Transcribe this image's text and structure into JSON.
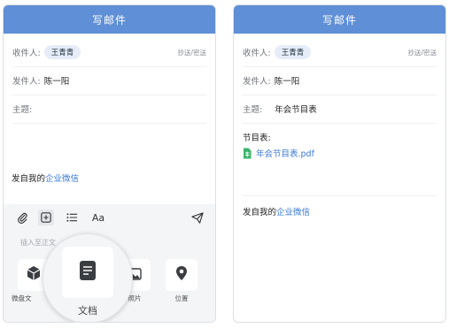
{
  "left": {
    "title": "写邮件",
    "to_label": "收件人:",
    "recipient": "王青青",
    "cc_bcc": "抄送/密送",
    "from_label": "发件人:",
    "from_value": "陈一阳",
    "subject_label": "主题:",
    "signature_prefix": "发自我的",
    "signature_link": "企业微信",
    "insert_hint": "插入至正文",
    "apps": [
      {
        "label": "微盘文",
        "icon": "cube-icon"
      },
      {
        "label": "照片",
        "icon": "photo-icon"
      },
      {
        "label": "位置",
        "icon": "location-pin-icon"
      }
    ],
    "zoom_label": "文档",
    "toolbar_text_icon": "Aa"
  },
  "right": {
    "title": "写邮件",
    "to_label": "收件人:",
    "recipient": "王青青",
    "cc_bcc": "抄送/密送",
    "from_label": "发件人:",
    "from_value": "陈一阳",
    "subject_label": "主题:",
    "subject_value": "年会节目表",
    "body_heading": "节目表:",
    "attachment_name": "年会节目表.pdf",
    "signature_prefix": "发自我的",
    "signature_link": "企业微信"
  },
  "colors": {
    "header_bg": "#5f8fd6",
    "link": "#3a79d9",
    "chip_bg": "#e6edf8",
    "attachment_icon": "#3bb36b"
  }
}
